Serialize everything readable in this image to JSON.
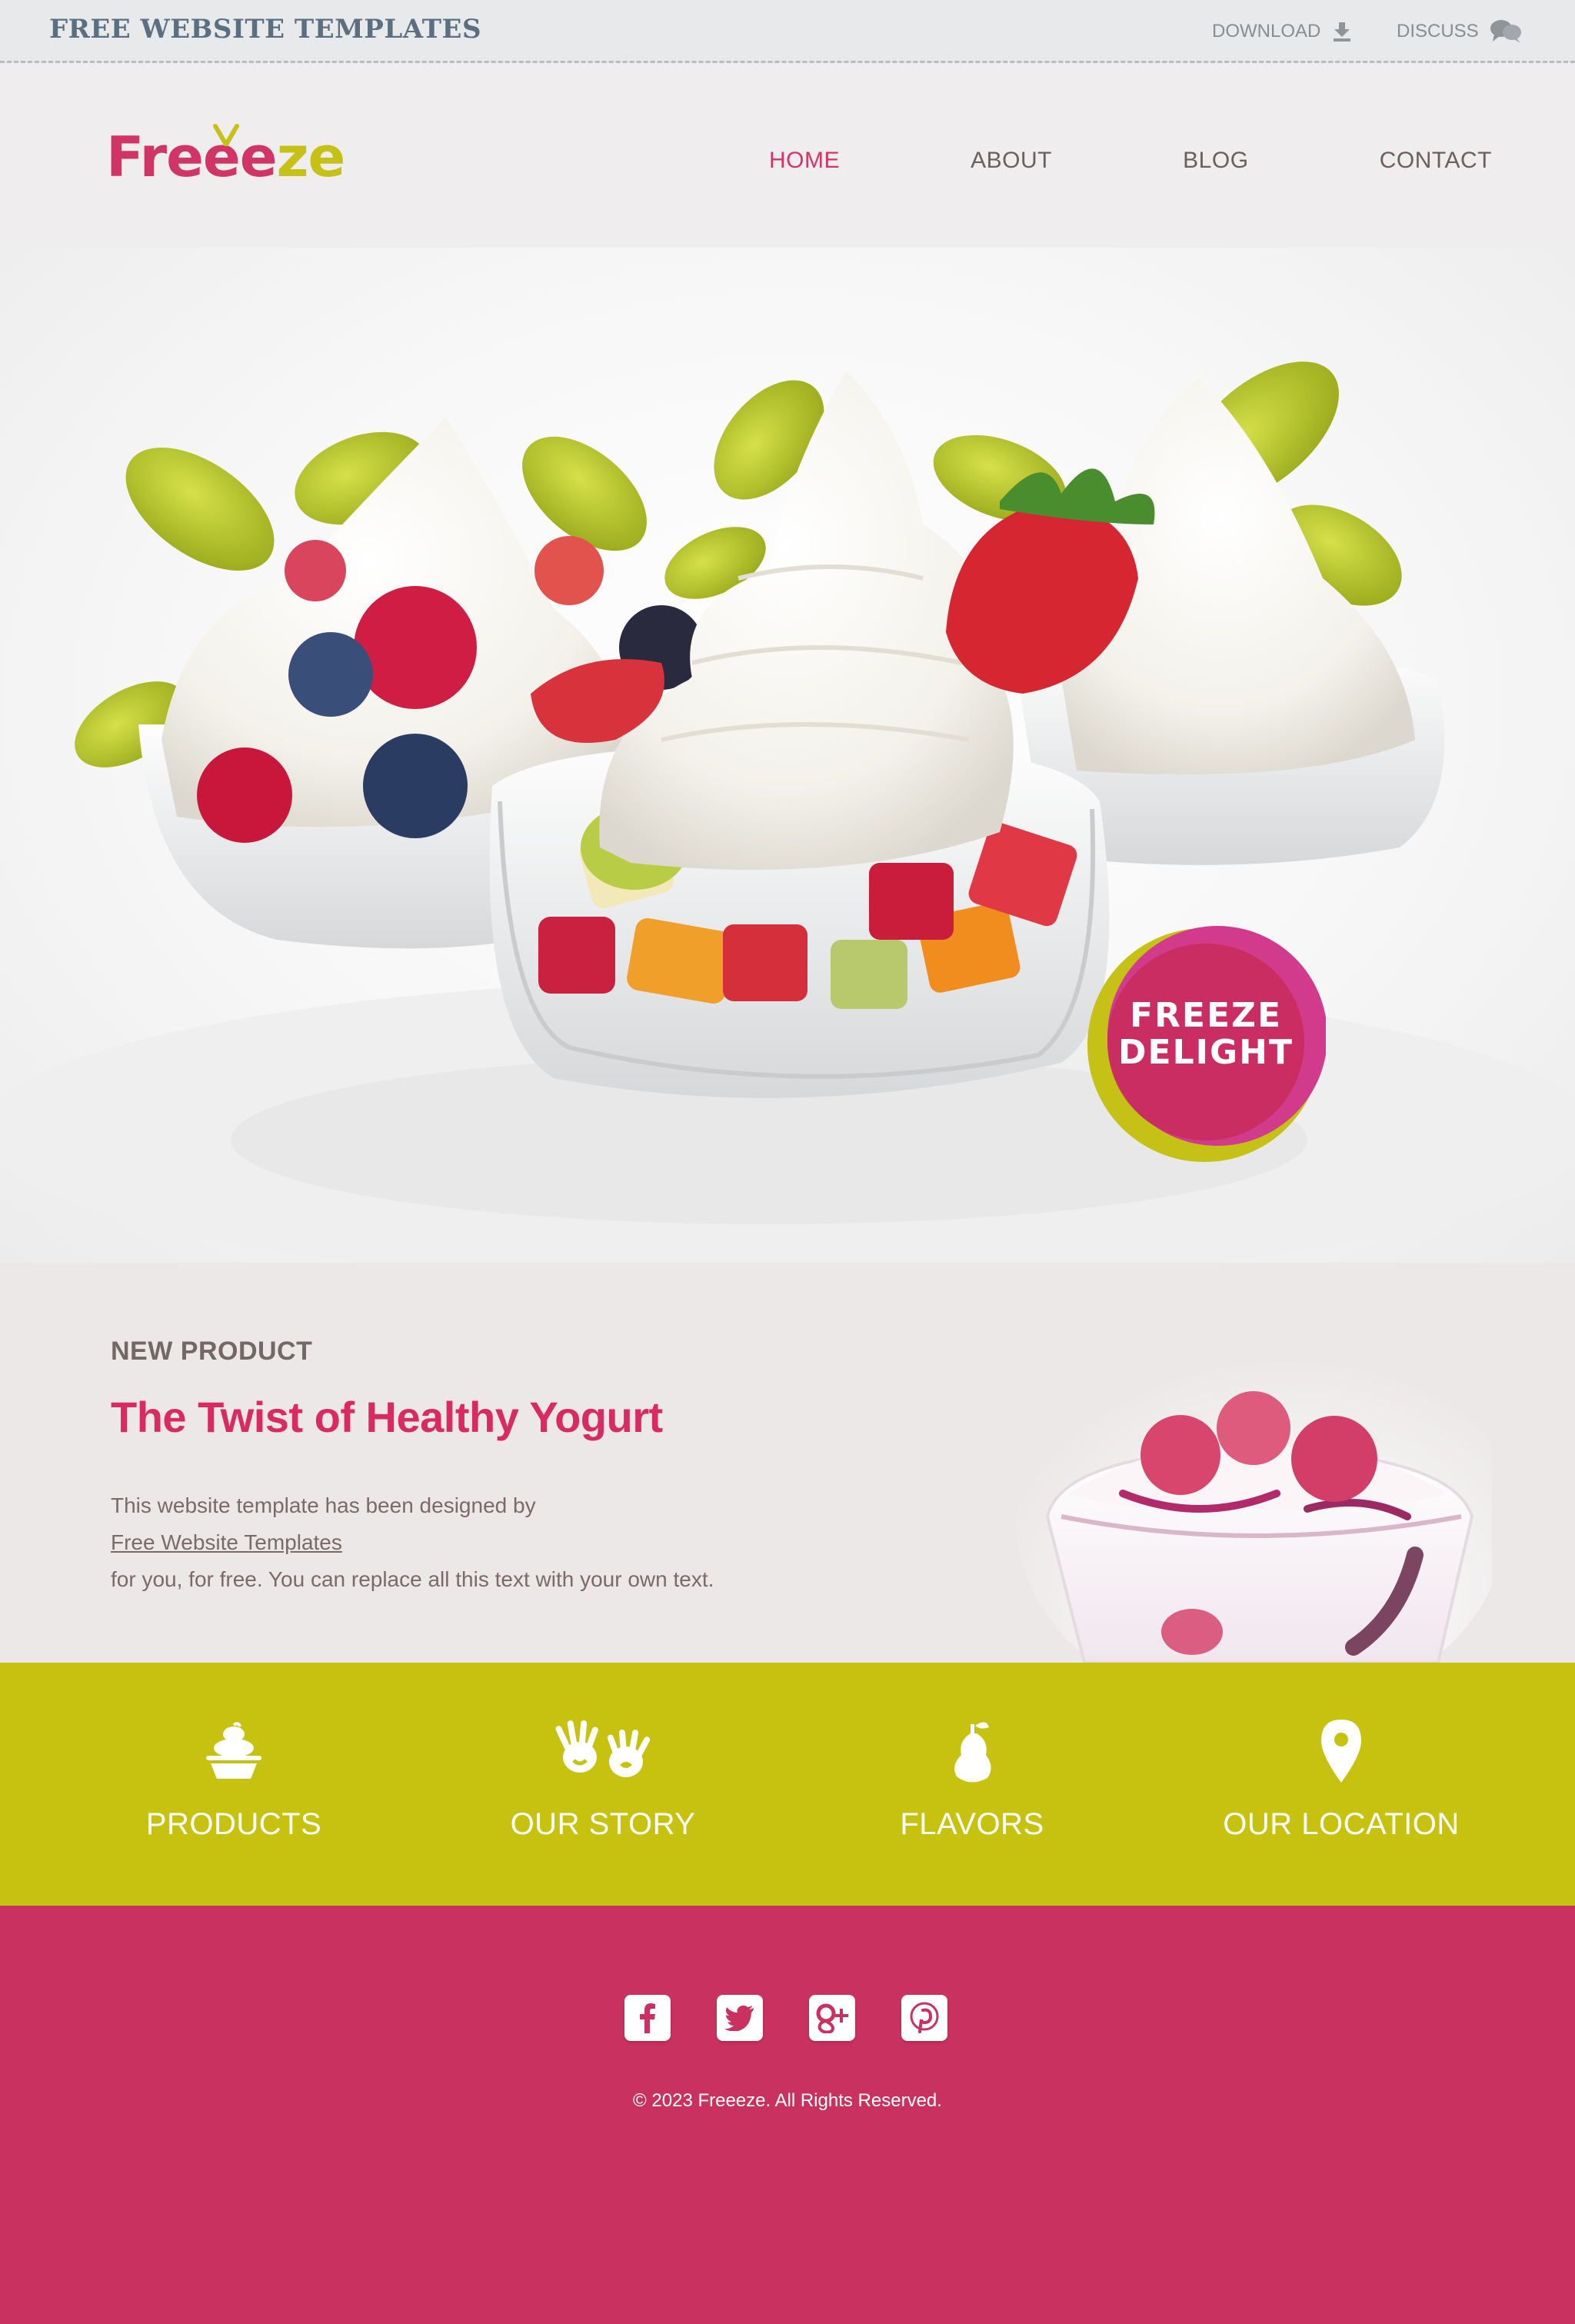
{
  "topbar": {
    "brand": "FREE WEBSITE TEMPLATES",
    "download_label": "DOWNLOAD",
    "discuss_label": "DISCUSS",
    "download_icon": "download-arrow-icon",
    "discuss_icon": "speech-bubbles-icon"
  },
  "header": {
    "logo_main": "Freee",
    "logo_accent": "ze",
    "nav": [
      {
        "label": "HOME",
        "active": true
      },
      {
        "label": "ABOUT",
        "active": false
      },
      {
        "label": "BLOG",
        "active": false
      },
      {
        "label": "CONTACT",
        "active": false
      }
    ]
  },
  "hero": {
    "badge_line1": "FREEZE",
    "badge_line2": "DELIGHT",
    "image": "frozen-yogurt-cups-with-fruit-and-leaves"
  },
  "product": {
    "eyebrow": "NEW PRODUCT",
    "heading": "The Twist of Healthy Yogurt",
    "body_line1": "This website template has been designed by",
    "body_link": "Free Website Templates",
    "body_line3": "for you, for free. You can replace all this text with your own text.",
    "image": "raspberry-yogurt-glass"
  },
  "features": [
    {
      "label": "PRODUCTS",
      "icon": "cupcake-icon"
    },
    {
      "label": "OUR STORY",
      "icon": "hands-icon"
    },
    {
      "label": "FLAVORS",
      "icon": "pear-icon"
    },
    {
      "label": "OUR LOCATION",
      "icon": "map-pin-icon"
    }
  ],
  "footer": {
    "socials": [
      "facebook-icon",
      "twitter-icon",
      "google-plus-icon",
      "pinterest-icon"
    ],
    "copyright": "© 2023 Freeeze. All Rights Reserved."
  },
  "colors": {
    "brand_pink": "#d1356a",
    "brand_lime": "#c6c20f",
    "footer_pink": "#c93260",
    "text_brown": "#736767"
  }
}
